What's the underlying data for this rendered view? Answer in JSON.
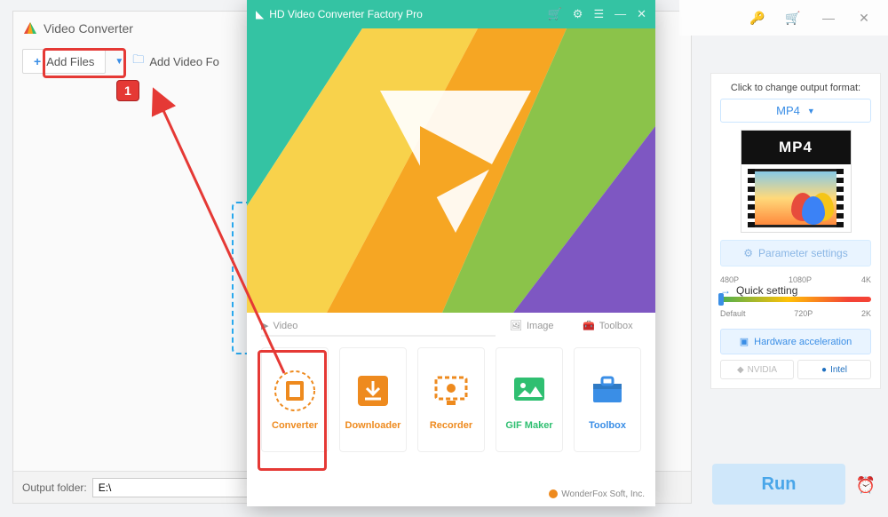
{
  "bg_window": {
    "title": "Video Converter",
    "add_files": "Add Files",
    "add_folder": "Add Video Fo",
    "output_folder_label": "Output folder:",
    "output_folder_value": "E:\\"
  },
  "top_right": {
    "key_icon": "key-icon",
    "cart_icon": "cart-icon",
    "min_icon": "minimize-icon",
    "close_icon": "close-icon"
  },
  "side_panel": {
    "click_label": "Click to change output format:",
    "format": "MP4",
    "mp4_badge": "MP4",
    "parameter_settings": "Parameter settings",
    "quick_setting": "Quick setting",
    "ticks_top": [
      "480P",
      "1080P",
      "4K"
    ],
    "ticks_bottom": [
      "Default",
      "720P",
      "2K"
    ],
    "hardware": "Hardware acceleration",
    "nvidia": "NVIDIA",
    "intel": "Intel"
  },
  "run_button": "Run",
  "launcher": {
    "title": "HD Video Converter Factory Pro",
    "sections": {
      "video": "Video",
      "image": "Image",
      "toolbox": "Toolbox"
    },
    "cards": {
      "converter": "Converter",
      "downloader": "Downloader",
      "recorder": "Recorder",
      "gifmaker": "GIF Maker",
      "toolbox": "Toolbox"
    },
    "footer": "WonderFox Soft, Inc."
  },
  "annotations": {
    "badge_1": "1"
  }
}
